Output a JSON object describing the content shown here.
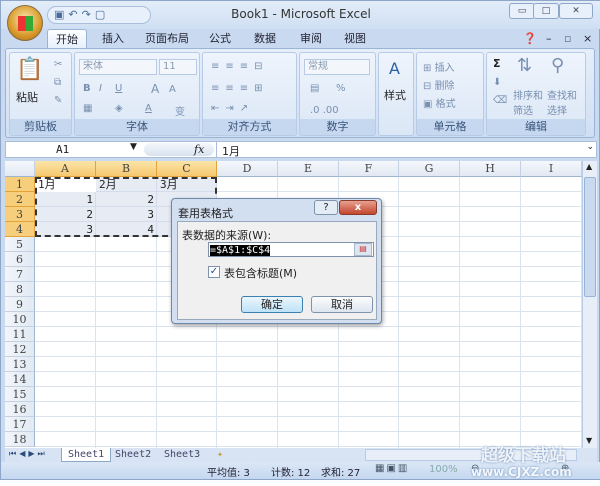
{
  "window": {
    "title": "Book1 - Microsoft Excel"
  },
  "qat": {
    "icons": [
      "save-icon",
      "undo-icon",
      "redo-icon",
      "print-preview-icon"
    ]
  },
  "tabs": [
    "开始",
    "插入",
    "页面布局",
    "公式",
    "数据",
    "审阅",
    "视图"
  ],
  "ribbon": {
    "clipboard": {
      "paste": "粘贴",
      "label": "剪贴板"
    },
    "font": {
      "name": "宋体",
      "size": "11",
      "bold": "B",
      "italic": "I",
      "underline": "U",
      "grow": "A",
      "shrink": "A",
      "phonetic": "变",
      "label": "字体"
    },
    "alignment": {
      "label": "对齐方式"
    },
    "number": {
      "format": "常规",
      "percent": "%",
      "label": "数字"
    },
    "styles": {
      "label": "样式"
    },
    "cells": {
      "insert": "插入",
      "delete": "删除",
      "format": "格式",
      "label": "单元格"
    },
    "editing": {
      "sigma": "Σ",
      "sort": "排序和",
      "sort2": "筛选",
      "find": "查找和",
      "find2": "选择",
      "label": "编辑"
    }
  },
  "formula_bar": {
    "name_box": "A1",
    "fx": "fx",
    "value": "1月"
  },
  "columns": [
    "A",
    "B",
    "C",
    "D",
    "E",
    "F",
    "G",
    "H",
    "I"
  ],
  "rows": [
    "1",
    "2",
    "3",
    "4",
    "5",
    "6",
    "7",
    "8",
    "9",
    "10",
    "11",
    "12",
    "13",
    "14",
    "15",
    "16",
    "17",
    "18"
  ],
  "cells": [
    [
      "1月",
      "2月",
      "3月"
    ],
    [
      "1",
      "2",
      ""
    ],
    [
      "2",
      "3",
      ""
    ],
    [
      "3",
      "4",
      ""
    ]
  ],
  "sheets": [
    "Sheet1",
    "Sheet2",
    "Sheet3"
  ],
  "status": {
    "average": "平均值: 3",
    "count": "计数: 12",
    "sum": "求和: 27",
    "zoom": "100%"
  },
  "dialog": {
    "title": "套用表格式",
    "help": "?",
    "close": "x",
    "source_label": "表数据的来源(W):",
    "source_value": "=$A$1:$C$4",
    "header_checkbox": "表包含标题(M)",
    "header_checked": true,
    "ok": "确定",
    "cancel": "取消"
  },
  "watermark": {
    "text": "超级下载站",
    "url": "www.CJXZ.com"
  }
}
